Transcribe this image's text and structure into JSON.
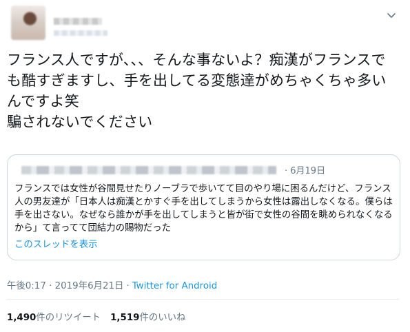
{
  "tweet": {
    "text": "フランス人ですが、、、そんな事ないよ？痴漢がフランスでも酷すぎますし、手を出してる変態達がめちゃくちゃ多いんですよ笑\n騙されないでください",
    "timestamp": "午後0:17 · 2019年6月21日",
    "source": "Twitter for Android"
  },
  "quoted": {
    "date": "· 6月19日",
    "text": "フランスでは女性が谷間見せたりノーブラで歩いてて目のやり場に困るんだけど、フランス人の男友達が「日本人は痴漢とかすぐ手を出してしまうから女性は露出しなくなる。僕らは手を出さない。なぜなら誰かが手を出してしまうと皆が街で女性の谷間を眺められなくなるから」て言ってて団結力の賜物だった",
    "show_thread": "このスレッドを表示"
  },
  "stats": {
    "retweets_count": "1,490",
    "retweets_label": "件のリツイート",
    "likes_count": "1,519",
    "likes_label": "件のいいね"
  },
  "colors": {
    "link": "#1b95e0",
    "muted": "#657786",
    "border": "#ccd6dd"
  },
  "icons": {
    "menu": "chevron-down-icon"
  }
}
